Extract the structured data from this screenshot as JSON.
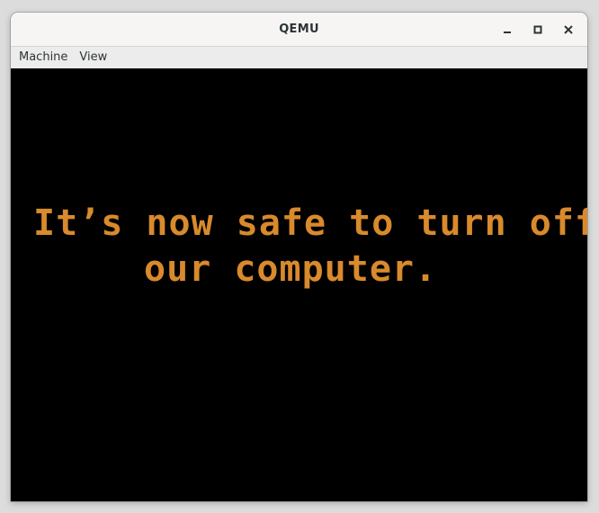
{
  "window": {
    "title": "QEMU",
    "controls": {
      "minimize": "minimize-icon",
      "maximize": "maximize-icon",
      "close": "close-icon"
    }
  },
  "menubar": {
    "items": [
      {
        "label": "Machine"
      },
      {
        "label": "View"
      }
    ]
  },
  "screen": {
    "background": "#000000",
    "text_color": "#d88a2c",
    "lines": [
      "It’s now safe to turn off",
      "our computer."
    ]
  }
}
